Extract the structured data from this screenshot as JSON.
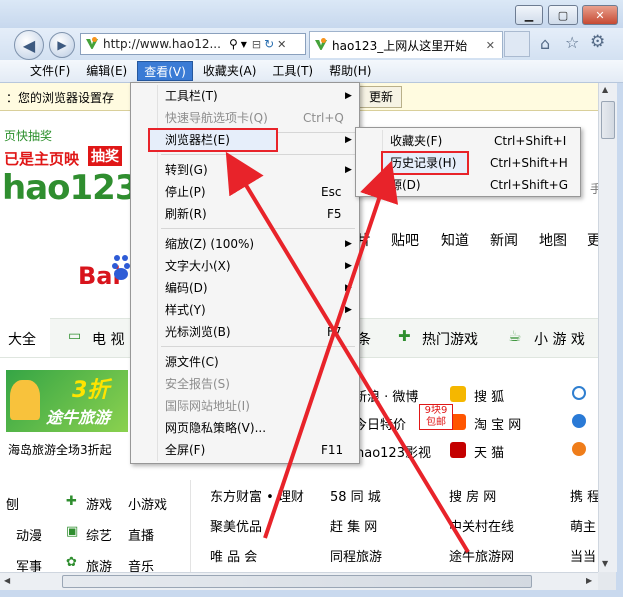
{
  "browser": {
    "address": "http://www.hao12...",
    "tab_title": "hao123_上网从这里开始",
    "back": "◀",
    "forward": "▶"
  },
  "menubar": [
    "文件(F)",
    "编辑(E)",
    "查看(V)",
    "收藏夹(A)",
    "工具(T)",
    "帮助(H)"
  ],
  "notify": {
    "text": "：您的浏览器设置存",
    "button": "更新"
  },
  "view_menu": [
    {
      "label": "工具栏(T)",
      "shortcut": "",
      "submenu": true,
      "disabled": false
    },
    {
      "label": "快速导航选项卡(Q)",
      "shortcut": "Ctrl+Q",
      "submenu": false,
      "disabled": true
    },
    {
      "label": "浏览器栏(E)",
      "shortcut": "",
      "submenu": true,
      "disabled": false,
      "highlighted": true
    },
    {
      "label": "转到(G)",
      "shortcut": "",
      "submenu": true,
      "disabled": false
    },
    {
      "label": "停止(P)",
      "shortcut": "Esc",
      "submenu": false,
      "disabled": false
    },
    {
      "label": "刷新(R)",
      "shortcut": "F5",
      "submenu": false,
      "disabled": false
    },
    {
      "label": "缩放(Z) (100%)",
      "shortcut": "",
      "submenu": true,
      "disabled": false
    },
    {
      "label": "文字大小(X)",
      "shortcut": "",
      "submenu": true,
      "disabled": false
    },
    {
      "label": "编码(D)",
      "shortcut": "",
      "submenu": true,
      "disabled": false
    },
    {
      "label": "样式(Y)",
      "shortcut": "",
      "submenu": true,
      "disabled": false
    },
    {
      "label": "光标浏览(B)",
      "shortcut": "F7",
      "submenu": false,
      "disabled": false
    },
    {
      "label": "源文件(C)",
      "shortcut": "",
      "submenu": false,
      "disabled": false
    },
    {
      "label": "安全报告(S)",
      "shortcut": "",
      "submenu": false,
      "disabled": true
    },
    {
      "label": "国际网站地址(I)",
      "shortcut": "",
      "submenu": false,
      "disabled": true
    },
    {
      "label": "网页隐私策略(V)...",
      "shortcut": "",
      "submenu": false,
      "disabled": false
    },
    {
      "label": "全屏(F)",
      "shortcut": "F11",
      "submenu": false,
      "disabled": false
    }
  ],
  "explorer_bar_menu": [
    {
      "label": "收藏夹(F)",
      "shortcut": "Ctrl+Shift+I"
    },
    {
      "label": "历史记录(H)",
      "shortcut": "Ctrl+Shift+H",
      "highlighted": true
    },
    {
      "label": "源(D)",
      "shortcut": "Ctrl+Shift+G"
    }
  ],
  "page": {
    "promo_left": "页快抽奖",
    "banner_text1": "已是主页映",
    "banner_text2": "抽奖",
    "logo": "hao123",
    "search_tabs": [
      "片",
      "贴吧",
      "知道",
      "新闻",
      "地图",
      "更"
    ],
    "baidu": "Bai",
    "side_letter": "手",
    "category_tabs": [
      "大全",
      "电 视",
      "条",
      "热门游戏",
      "小 游 戏"
    ],
    "ad_text1": "3折",
    "ad_text2": "途牛旅游",
    "ad_caption": "海岛旅游全场3折起",
    "sites_row1": [
      "新浪 · 微博",
      "搜 狐",
      ""
    ],
    "sites_row2": [
      "今日特价",
      "淘 宝 网",
      ""
    ],
    "sites_row3": [
      "hao123影视",
      "天 猫",
      ""
    ],
    "badge": "9块9 包邮",
    "left_links": [
      [
        "刨",
        "游戏",
        "小游戏"
      ],
      [
        "动漫",
        "综艺",
        "直播"
      ],
      [
        "军事",
        "旅游",
        "音乐"
      ]
    ],
    "grid": [
      [
        "东方财富 • 理财",
        "58 同 城",
        "搜 房 网",
        "携 程"
      ],
      [
        "聚美优品",
        "赶 集 网",
        "中关村在线",
        "萌主"
      ],
      [
        "唯 品 会",
        "同程旅游",
        "途牛旅游网",
        "当当"
      ]
    ]
  },
  "colors": {
    "accent": "#3a7bd5",
    "highlight_border": "#e8232a",
    "arrow": "#e8232a"
  }
}
